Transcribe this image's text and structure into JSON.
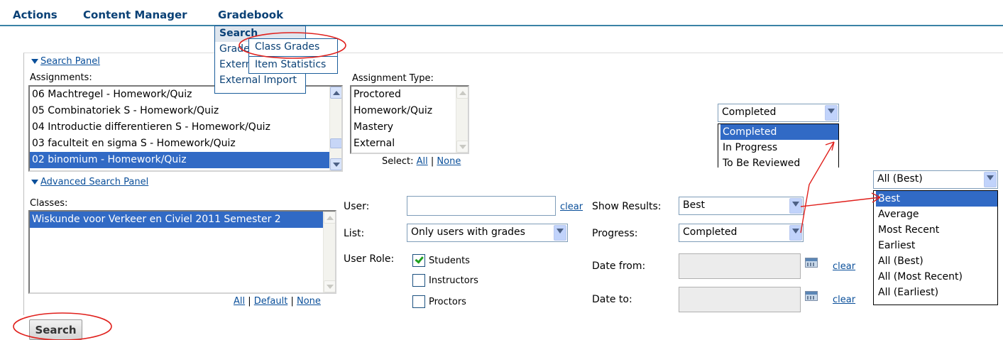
{
  "menu": {
    "actions": "Actions",
    "content_manager": "Content Manager",
    "gradebook": "Gradebook"
  },
  "gradebook_menu": {
    "search": "Search",
    "grades": "Grades",
    "external": "External",
    "external_import": "External Import"
  },
  "search_submenu": {
    "class_grades": "Class Grades",
    "item_statistics": "Item Statistics"
  },
  "search_panel": {
    "toggle": "Search Panel",
    "assignments_label": "Assignments:",
    "assignments": [
      "06 Machtregel - Homework/Quiz",
      "05 Combinatoriek S - Homework/Quiz",
      "04 Introductie differentieren S - Homework/Quiz",
      "03 faculteit en sigma S - Homework/Quiz",
      "02 binomium - Homework/Quiz"
    ],
    "assignment_type_label": "Assignment Type:",
    "assignment_types": [
      "Proctored",
      "Homework/Quiz",
      "Mastery",
      "External"
    ],
    "select_label": "Select:",
    "all": "All",
    "none": "None",
    "separator": "|"
  },
  "status_dropdown": {
    "value": "Completed",
    "options": [
      "Completed",
      "In Progress",
      "To Be Reviewed"
    ]
  },
  "advanced_panel": {
    "toggle": "Advanced Search Panel",
    "classes_label": "Classes:",
    "classes": [
      "Wiskunde voor Verkeer en Civiel 2011 Semester 2"
    ],
    "all": "All",
    "default": "Default",
    "none": "None",
    "user_label": "User:",
    "user_value": "",
    "clear": "clear",
    "list_label": "List:",
    "list_value": "Only users with grades",
    "user_role_label": "User Role:",
    "roles": [
      {
        "label": "Students",
        "checked": true
      },
      {
        "label": "Instructors",
        "checked": false
      },
      {
        "label": "Proctors",
        "checked": false
      }
    ],
    "show_results_label": "Show Results:",
    "show_results_value": "Best",
    "progress_label": "Progress:",
    "progress_value": "Completed",
    "date_from_label": "Date from:",
    "date_to_label": "Date to:"
  },
  "results_dropdown": {
    "value": "All (Best)",
    "options": [
      "Best",
      "Average",
      "Most Recent",
      "Earliest",
      "All (Best)",
      "All (Most Recent)",
      "All (Earliest)"
    ]
  },
  "search_button": "Search",
  "colors": {
    "link": "#0a4f9a",
    "selection": "#316ac5",
    "annotation": "#e0201c"
  }
}
